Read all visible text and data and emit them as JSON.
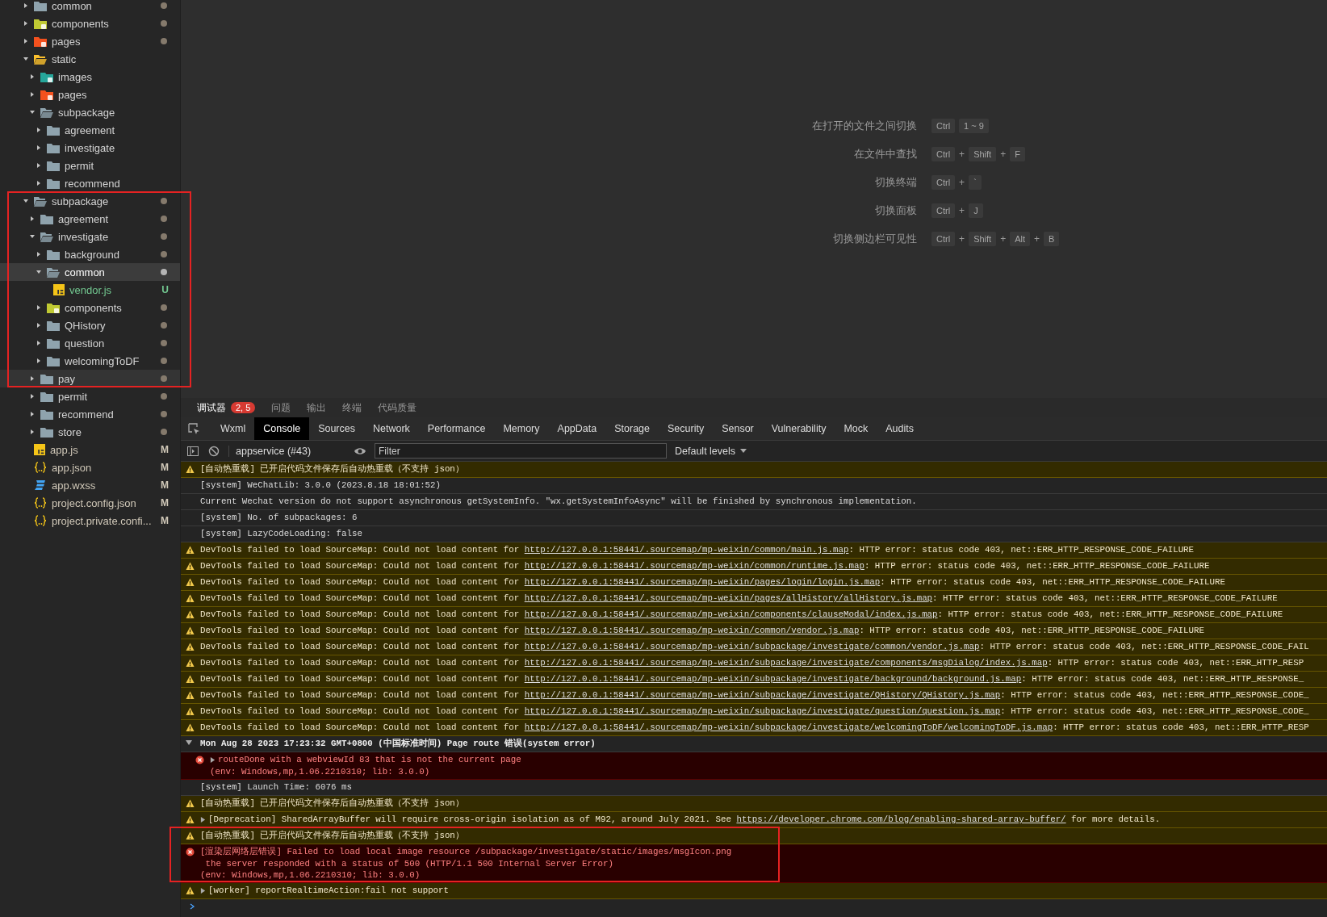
{
  "tree": [
    {
      "name": "common",
      "kind": "folder",
      "expanded": false,
      "selected": false,
      "hover": false,
      "dot": true
    },
    {
      "name": "components",
      "kind": "components",
      "expanded": false,
      "selected": false,
      "hover": false,
      "dot": true
    },
    {
      "name": "pages",
      "kind": "pages",
      "expanded": false,
      "selected": false,
      "hover": false,
      "dot": true
    },
    {
      "name": "static",
      "kind": "static",
      "expanded": true,
      "selected": false,
      "hover": false,
      "dot": false,
      "children": [
        {
          "name": "images",
          "kind": "images",
          "expanded": false,
          "selected": false,
          "hover": false,
          "dot": false
        },
        {
          "name": "pages",
          "kind": "pages",
          "expanded": false,
          "selected": false,
          "hover": false,
          "dot": false
        },
        {
          "name": "subpackage",
          "kind": "folder",
          "expanded": true,
          "selected": false,
          "hover": false,
          "dot": false,
          "children": [
            {
              "name": "agreement",
              "kind": "folder",
              "expanded": false,
              "selected": false,
              "hover": false,
              "dot": false
            },
            {
              "name": "investigate",
              "kind": "folder",
              "expanded": false,
              "selected": false,
              "hover": false,
              "dot": false
            },
            {
              "name": "permit",
              "kind": "folder",
              "expanded": false,
              "selected": false,
              "hover": false,
              "dot": false
            },
            {
              "name": "recommend",
              "kind": "folder",
              "expanded": false,
              "selected": false,
              "hover": false,
              "dot": false
            }
          ]
        }
      ]
    },
    {
      "name": "subpackage",
      "kind": "folder",
      "expanded": true,
      "selected": false,
      "hover": false,
      "dot": true,
      "children": [
        {
          "name": "agreement",
          "kind": "folder",
          "expanded": false,
          "selected": false,
          "hover": false,
          "dot": true
        },
        {
          "name": "investigate",
          "kind": "folder",
          "expanded": true,
          "selected": false,
          "hover": false,
          "dot": true,
          "children": [
            {
              "name": "background",
              "kind": "folder",
              "expanded": false,
              "selected": false,
              "hover": false,
              "dot": true
            },
            {
              "name": "common",
              "kind": "folder",
              "expanded": true,
              "selected": true,
              "hover": false,
              "dot": true,
              "children": [
                {
                  "name": "vendor.js",
                  "kind": "js",
                  "selected": false,
                  "hover": false,
                  "dot": false,
                  "badge": "U",
                  "color": "#73c991"
                }
              ]
            },
            {
              "name": "components",
              "kind": "components",
              "expanded": false,
              "selected": false,
              "hover": false,
              "dot": true
            },
            {
              "name": "QHistory",
              "kind": "folder",
              "expanded": false,
              "selected": false,
              "hover": false,
              "dot": true
            },
            {
              "name": "question",
              "kind": "folder",
              "expanded": false,
              "selected": false,
              "hover": false,
              "dot": true
            },
            {
              "name": "welcomingToDF",
              "kind": "folder",
              "expanded": false,
              "selected": false,
              "hover": false,
              "dot": true
            }
          ]
        },
        {
          "name": "pay",
          "kind": "folder",
          "expanded": false,
          "selected": false,
          "hover": true,
          "dot": true
        },
        {
          "name": "permit",
          "kind": "folder",
          "expanded": false,
          "selected": false,
          "hover": false,
          "dot": true
        },
        {
          "name": "recommend",
          "kind": "folder",
          "expanded": false,
          "selected": false,
          "hover": false,
          "dot": true
        },
        {
          "name": "store",
          "kind": "folder",
          "expanded": false,
          "selected": false,
          "hover": false,
          "dot": true
        }
      ]
    },
    {
      "name": "app.js",
      "kind": "js",
      "selected": false,
      "hover": false,
      "dot": false,
      "badge": "M",
      "color": "#d0c8b8"
    },
    {
      "name": "app.json",
      "kind": "json",
      "selected": false,
      "hover": false,
      "dot": false,
      "badge": "M",
      "color": "#d0c8b8"
    },
    {
      "name": "app.wxss",
      "kind": "wxss",
      "selected": false,
      "hover": false,
      "dot": false,
      "badge": "M",
      "color": "#d0c8b8"
    },
    {
      "name": "project.config.json",
      "kind": "json",
      "selected": false,
      "hover": false,
      "dot": false,
      "badge": "M",
      "color": "#d0c8b8"
    },
    {
      "name": "project.private.confi...",
      "kind": "json",
      "selected": false,
      "hover": false,
      "dot": false,
      "badge": "M",
      "color": "#d0c8b8"
    }
  ],
  "shortcuts": [
    {
      "label": "在打开的文件之间切换",
      "keys": [
        {
          "kind": "key",
          "text": "Ctrl"
        },
        {
          "kind": "key",
          "text": "1 ~ 9"
        }
      ]
    },
    {
      "label": "在文件中查找",
      "keys": [
        {
          "kind": "key",
          "text": "Ctrl"
        },
        {
          "kind": "plus",
          "text": "+"
        },
        {
          "kind": "key",
          "text": "Shift"
        },
        {
          "kind": "plus",
          "text": "+"
        },
        {
          "kind": "key",
          "text": "F"
        }
      ]
    },
    {
      "label": "切换终端",
      "keys": [
        {
          "kind": "key",
          "text": "Ctrl"
        },
        {
          "kind": "plus",
          "text": "+"
        },
        {
          "kind": "key",
          "text": "`"
        }
      ]
    },
    {
      "label": "切换面板",
      "keys": [
        {
          "kind": "key",
          "text": "Ctrl"
        },
        {
          "kind": "plus",
          "text": "+"
        },
        {
          "kind": "key",
          "text": "J"
        }
      ]
    },
    {
      "label": "切换侧边栏可见性",
      "keys": [
        {
          "kind": "key",
          "text": "Ctrl"
        },
        {
          "kind": "plus",
          "text": "+"
        },
        {
          "kind": "key",
          "text": "Shift"
        },
        {
          "kind": "plus",
          "text": "+"
        },
        {
          "kind": "key",
          "text": "Alt"
        },
        {
          "kind": "plus",
          "text": "+"
        },
        {
          "kind": "key",
          "text": "B"
        }
      ]
    }
  ],
  "panel_tabs": [
    {
      "label": "调试器",
      "selected": true,
      "badge": "2, 5"
    },
    {
      "label": "问题",
      "selected": false
    },
    {
      "label": "输出",
      "selected": false
    },
    {
      "label": "终端",
      "selected": false
    },
    {
      "label": "代码质量",
      "selected": false
    }
  ],
  "devtools_tabs": [
    {
      "label": "Wxml",
      "selected": false
    },
    {
      "label": "Console",
      "selected": true
    },
    {
      "label": "Sources",
      "selected": false
    },
    {
      "label": "Network",
      "selected": false
    },
    {
      "label": "Performance",
      "selected": false
    },
    {
      "label": "Memory",
      "selected": false
    },
    {
      "label": "AppData",
      "selected": false
    },
    {
      "label": "Storage",
      "selected": false
    },
    {
      "label": "Security",
      "selected": false
    },
    {
      "label": "Sensor",
      "selected": false
    },
    {
      "label": "Vulnerability",
      "selected": false
    },
    {
      "label": "Mock",
      "selected": false
    },
    {
      "label": "Audits",
      "selected": false
    }
  ],
  "console_toolbar": {
    "context": "appservice (#43)",
    "filter_placeholder": "Filter",
    "levels": "Default levels"
  },
  "console": [
    {
      "kind": "warning",
      "text": "[自动热重载] 已开启代码文件保存后自动热重载（不支持 json）"
    },
    {
      "kind": "info",
      "text": "[system] WeChatLib: 3.0.0 (2023.8.18 18:01:52)"
    },
    {
      "kind": "info",
      "text": "Current Wechat version do not support asynchronous getSystemInfo. \"wx.getSystemInfoAsync\" will be finished by synchronous implementation."
    },
    {
      "kind": "info",
      "text": "[system] No. of subpackages: 6"
    },
    {
      "kind": "info",
      "text": "[system] LazyCodeLoading: false"
    },
    {
      "kind": "warning",
      "text": "DevTools failed to load SourceMap: Could not load content for ",
      "link": "http://127.0.0.1:58441/.sourcemap/mp-weixin/common/main.js.map",
      "after": ": HTTP error: status code 403, net::ERR_HTTP_RESPONSE_CODE_FAILURE"
    },
    {
      "kind": "warning",
      "text": "DevTools failed to load SourceMap: Could not load content for ",
      "link": "http://127.0.0.1:58441/.sourcemap/mp-weixin/common/runtime.js.map",
      "after": ": HTTP error: status code 403, net::ERR_HTTP_RESPONSE_CODE_FAILURE"
    },
    {
      "kind": "warning",
      "text": "DevTools failed to load SourceMap: Could not load content for ",
      "link": "http://127.0.0.1:58441/.sourcemap/mp-weixin/pages/login/login.js.map",
      "after": ": HTTP error: status code 403, net::ERR_HTTP_RESPONSE_CODE_FAILURE"
    },
    {
      "kind": "warning",
      "text": "DevTools failed to load SourceMap: Could not load content for ",
      "link": "http://127.0.0.1:58441/.sourcemap/mp-weixin/pages/allHistory/allHistory.js.map",
      "after": ": HTTP error: status code 403, net::ERR_HTTP_RESPONSE_CODE_FAILURE"
    },
    {
      "kind": "warning",
      "text": "DevTools failed to load SourceMap: Could not load content for ",
      "link": "http://127.0.0.1:58441/.sourcemap/mp-weixin/components/clauseModal/index.js.map",
      "after": ": HTTP error: status code 403, net::ERR_HTTP_RESPONSE_CODE_FAILURE"
    },
    {
      "kind": "warning",
      "text": "DevTools failed to load SourceMap: Could not load content for ",
      "link": "http://127.0.0.1:58441/.sourcemap/mp-weixin/common/vendor.js.map",
      "after": ": HTTP error: status code 403, net::ERR_HTTP_RESPONSE_CODE_FAILURE"
    },
    {
      "kind": "warning",
      "text": "DevTools failed to load SourceMap: Could not load content for ",
      "link": "http://127.0.0.1:58441/.sourcemap/mp-weixin/subpackage/investigate/common/vendor.js.map",
      "after": ": HTTP error: status code 403, net::ERR_HTTP_RESPONSE_CODE_FAIL"
    },
    {
      "kind": "warning",
      "text": "DevTools failed to load SourceMap: Could not load content for ",
      "link": "http://127.0.0.1:58441/.sourcemap/mp-weixin/subpackage/investigate/components/msgDialog/index.js.map",
      "after": ": HTTP error: status code 403, net::ERR_HTTP_RESP"
    },
    {
      "kind": "warning",
      "text": "DevTools failed to load SourceMap: Could not load content for ",
      "link": "http://127.0.0.1:58441/.sourcemap/mp-weixin/subpackage/investigate/background/background.js.map",
      "after": ": HTTP error: status code 403, net::ERR_HTTP_RESPONSE_"
    },
    {
      "kind": "warning",
      "text": "DevTools failed to load SourceMap: Could not load content for ",
      "link": "http://127.0.0.1:58441/.sourcemap/mp-weixin/subpackage/investigate/QHistory/QHistory.js.map",
      "after": ": HTTP error: status code 403, net::ERR_HTTP_RESPONSE_CODE_"
    },
    {
      "kind": "warning",
      "text": "DevTools failed to load SourceMap: Could not load content for ",
      "link": "http://127.0.0.1:58441/.sourcemap/mp-weixin/subpackage/investigate/question/question.js.map",
      "after": ": HTTP error: status code 403, net::ERR_HTTP_RESPONSE_CODE_"
    },
    {
      "kind": "warning",
      "text": "DevTools failed to load SourceMap: Could not load content for ",
      "link": "http://127.0.0.1:58441/.sourcemap/mp-weixin/subpackage/investigate/welcomingToDF/welcomingToDF.js.map",
      "after": ": HTTP error: status code 403, net::ERR_HTTP_RESP"
    },
    {
      "kind": "group",
      "expanded": true,
      "text": "Mon Aug 28 2023 17:23:32 GMT+0800 (中国标准时间) Page route 错误(system error)",
      "children": [
        {
          "kind": "error",
          "expanded": false,
          "text": "routeDone with a webviewId 83 that is not the current page",
          "more": [
            "(env: Windows,mp,1.06.2210310; lib: 3.0.0)"
          ]
        }
      ]
    },
    {
      "kind": "info",
      "text": "[system] Launch Time: 6076 ms"
    },
    {
      "kind": "warning",
      "text": "[自动热重载] 已开启代码文件保存后自动热重载（不支持 json）"
    },
    {
      "kind": "warning",
      "expanded": false,
      "text": "[Deprecation] SharedArrayBuffer will require cross-origin isolation as of M92, around July 2021. See ",
      "link": "https://developer.chrome.com/blog/enabling-shared-array-buffer/",
      "after": " for more details."
    },
    {
      "kind": "warning",
      "text": "[自动热重载] 已开启代码文件保存后自动热重载（不支持 json）"
    },
    {
      "kind": "error",
      "text": "[渲染层网络层错误] Failed to load local image resource /subpackage/investigate/static/images/msgIcon.png",
      "more": [
        " the server responded with a status of 500 (HTTP/1.1 500 Internal Server Error)",
        "(env: Windows,mp,1.06.2210310; lib: 3.0.0)"
      ]
    },
    {
      "kind": "warning",
      "expanded": false,
      "text": "[worker] reportRealtimeAction:fail not support"
    }
  ],
  "annotations": [
    {
      "kind": "frame"
    },
    {
      "kind": "frame"
    }
  ]
}
